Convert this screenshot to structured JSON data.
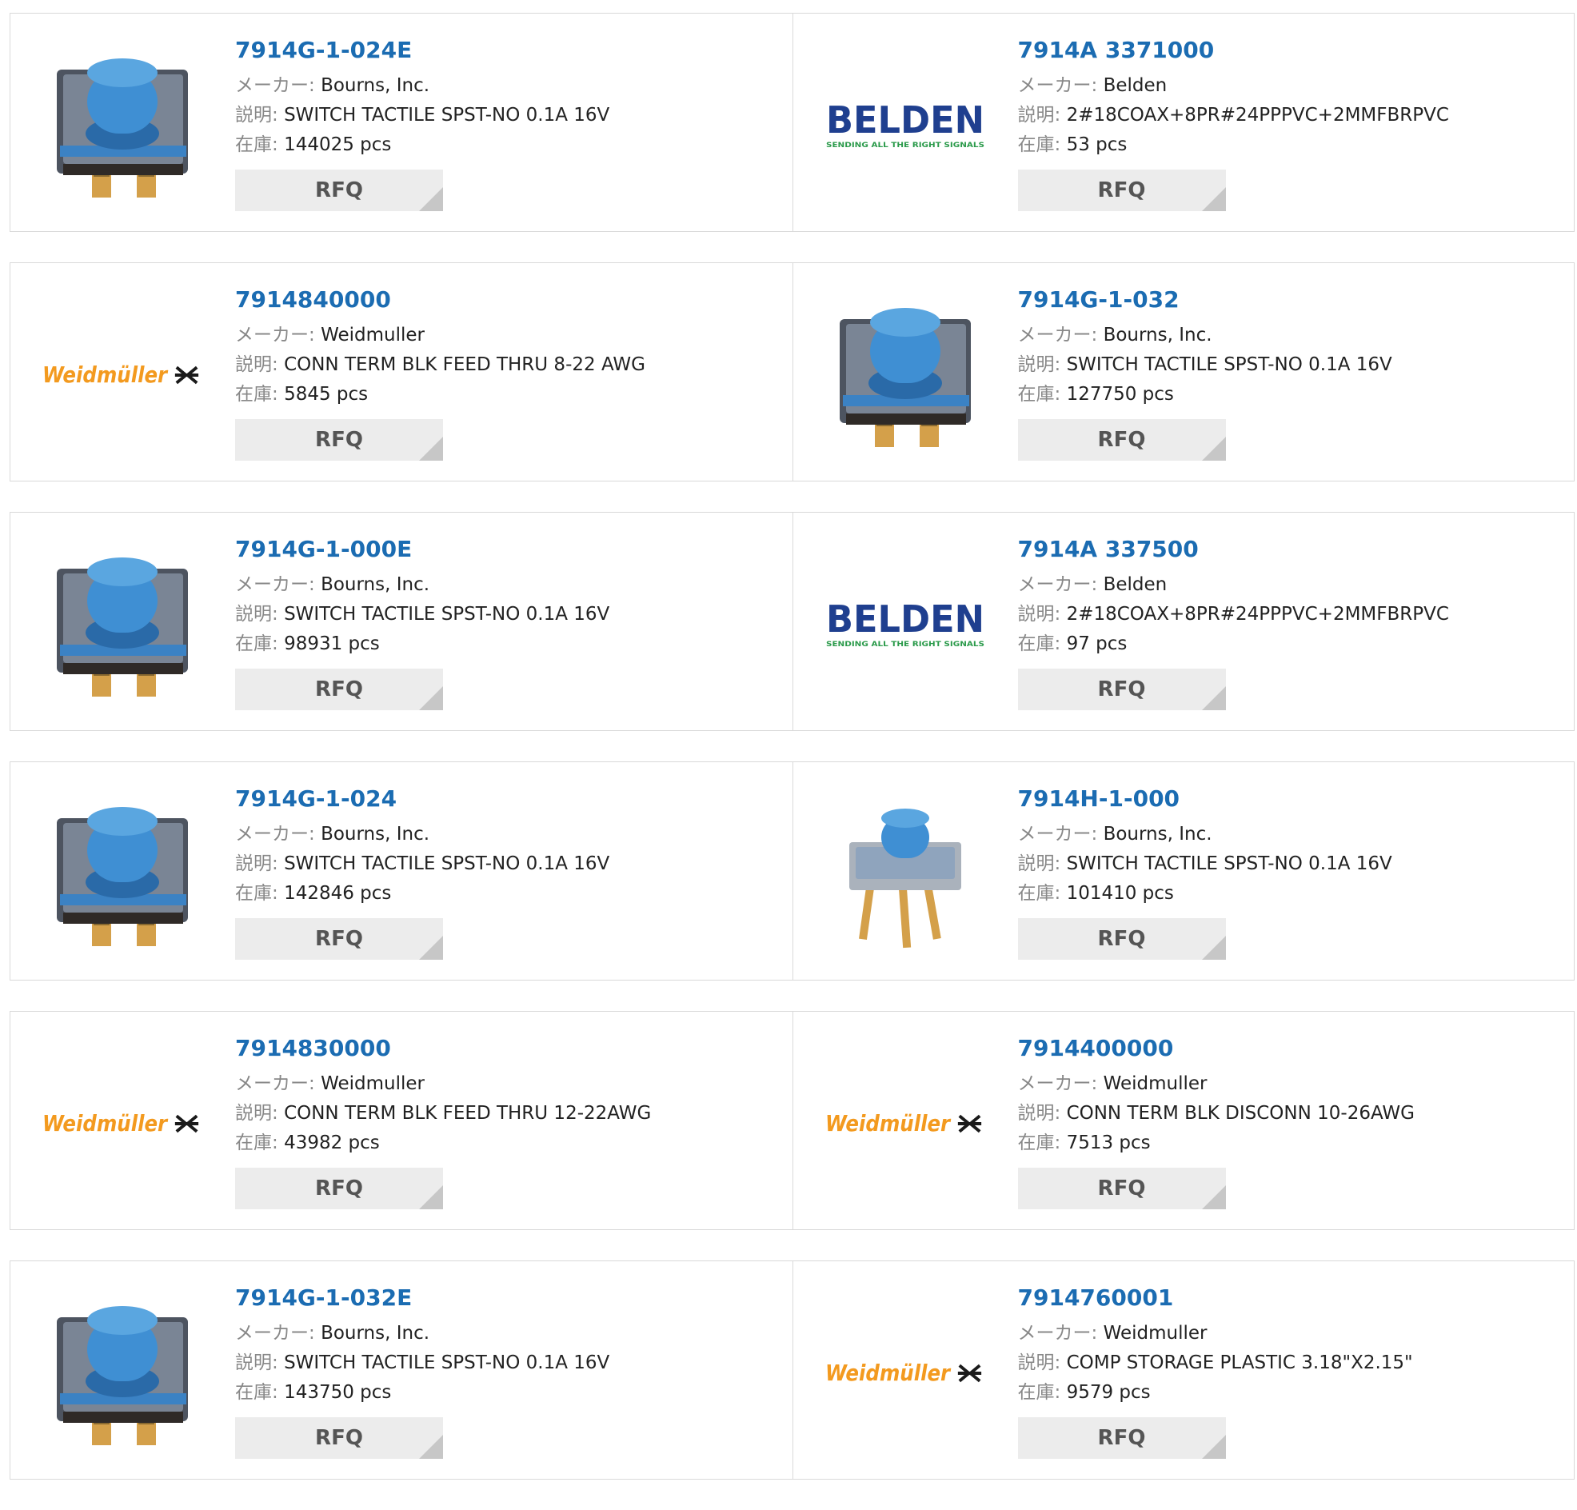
{
  "labels": {
    "maker": "メーカー:",
    "desc": "説明:",
    "stock": "在庫:",
    "rfq": "RFQ"
  },
  "logos": {
    "belden": {
      "name": "BELDEN",
      "tagline": "SENDING ALL THE RIGHT SIGNALS",
      "color": "#1f3f8f",
      "tagline_color": "#2a9a4a"
    },
    "weidmuller": {
      "name": "Weidmüller",
      "color": "#f39a1f"
    }
  },
  "colors": {
    "link": "#1b6cb2",
    "button_bg": "#ececec",
    "switch_blue": "#3f8fd3"
  },
  "rows": [
    {
      "cards": [
        {
          "part": "7914G-1-024E",
          "maker": "Bourns, Inc.",
          "desc": "SWITCH TACTILE SPST-NO 0.1A 16V",
          "stock": "144025 pcs",
          "image": "smd-switch-icon"
        },
        {
          "part": "7914A 3371000",
          "maker": "Belden",
          "desc": "2#18COAX+8PR#24PPPVC+2MMFBRPVC",
          "stock": "53 pcs",
          "image": "belden-logo"
        }
      ]
    },
    {
      "cards": [
        {
          "part": "7914840000",
          "maker": "Weidmuller",
          "desc": "CONN TERM BLK FEED THRU 8-22 AWG",
          "stock": "5845 pcs",
          "image": "weidmuller-logo"
        },
        {
          "part": "7914G-1-032",
          "maker": "Bourns, Inc.",
          "desc": "SWITCH TACTILE SPST-NO 0.1A 16V",
          "stock": "127750 pcs",
          "image": "smd-switch-icon"
        }
      ]
    },
    {
      "cards": [
        {
          "part": "7914G-1-000E",
          "maker": "Bourns, Inc.",
          "desc": "SWITCH TACTILE SPST-NO 0.1A 16V",
          "stock": "98931 pcs",
          "image": "smd-switch-icon"
        },
        {
          "part": "7914A 337500",
          "maker": "Belden",
          "desc": "2#18COAX+8PR#24PPPVC+2MMFBRPVC",
          "stock": "97 pcs",
          "image": "belden-logo"
        }
      ]
    },
    {
      "cards": [
        {
          "part": "7914G-1-024",
          "maker": "Bourns, Inc.",
          "desc": "SWITCH TACTILE SPST-NO 0.1A 16V",
          "stock": "142846 pcs",
          "image": "smd-switch-icon"
        },
        {
          "part": "7914H-1-000",
          "maker": "Bourns, Inc.",
          "desc": "SWITCH TACTILE SPST-NO 0.1A 16V",
          "stock": "101410 pcs",
          "image": "th-switch-icon"
        }
      ]
    },
    {
      "cards": [
        {
          "part": "7914830000",
          "maker": "Weidmuller",
          "desc": "CONN TERM BLK FEED THRU 12-22AWG",
          "stock": "43982 pcs",
          "image": "weidmuller-logo"
        },
        {
          "part": "7914400000",
          "maker": "Weidmuller",
          "desc": "CONN TERM BLK DISCONN 10-26AWG",
          "stock": "7513 pcs",
          "image": "weidmuller-logo"
        }
      ]
    },
    {
      "cards": [
        {
          "part": "7914G-1-032E",
          "maker": "Bourns, Inc.",
          "desc": "SWITCH TACTILE SPST-NO 0.1A 16V",
          "stock": "143750 pcs",
          "image": "smd-switch-icon"
        },
        {
          "part": "7914760001",
          "maker": "Weidmuller",
          "desc": "COMP STORAGE PLASTIC 3.18\"X2.15\"",
          "stock": "9579 pcs",
          "image": "weidmuller-logo"
        }
      ]
    }
  ]
}
